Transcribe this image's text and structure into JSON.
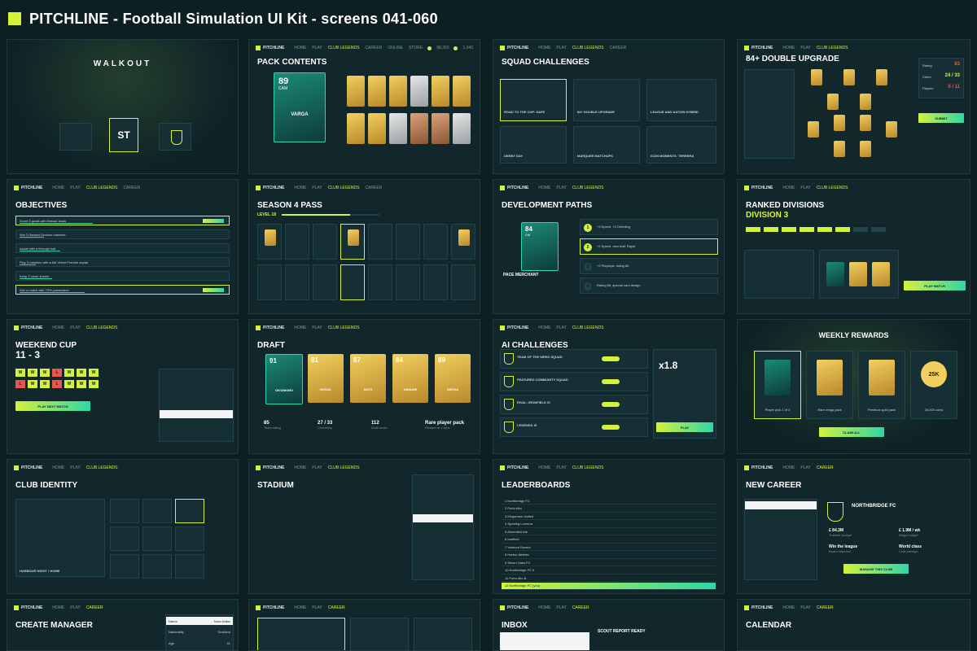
{
  "header": {
    "title": "PITCHLINE  -  Football Simulation UI Kit  -  screens 041-060"
  },
  "nav": [
    "HOME",
    "PLAY",
    "CLUB LEGENDS",
    "CAREER",
    "ONLINE",
    "STORE"
  ],
  "brand": "PITCHLINE",
  "coins": [
    "98,250",
    "1,340"
  ],
  "walkout": {
    "title": "WALKOUT",
    "slot_center": "ST"
  },
  "pack": {
    "title": "PACK CONTENTS",
    "rating": "89",
    "pos": "CAM",
    "name": "VARGA",
    "stats": [
      "84",
      "SPD",
      "89",
      "SHO",
      "91",
      "PAS",
      "86",
      "DRI",
      "60",
      "DEF",
      "82",
      "PHY"
    ]
  },
  "squad": {
    "title": "SQUAD CHALLENGES",
    "items": [
      "ROAD TO THE CUP: SAFE",
      "84+ DOUBLE UPGRADE",
      "LEAGUE AND NATION HYBRID",
      "DERBY DAY",
      "MARQUEE MATCHUPS",
      "ICON MOMENTS: TERRERA"
    ]
  },
  "upgrade": {
    "title": "84+ DOUBLE UPGRADE",
    "stats": [
      [
        "Rating",
        "83"
      ],
      [
        "Chem",
        "24 / 33"
      ],
      [
        "Players",
        "9 / 11"
      ]
    ],
    "submit": "SUBMIT"
  },
  "objectives": {
    "title": "OBJECTIVES",
    "rows": [
      "Score 5 goals with finesse shots",
      "Win 3 Ranked Division matches",
      "Assist with a through ball",
      "Play 3 matches with a full Velvet Premier squad",
      "Keep 2 clean sheets",
      "Win a match with 70% possession"
    ]
  },
  "pass": {
    "title": "SEASON 4 PASS",
    "level": "LEVEL 18"
  },
  "dev": {
    "title": "DEVELOPMENT PATHS",
    "rating": "84",
    "pos": "CM",
    "name": "PACE MERCHANT",
    "steps": [
      "+3 Speed, +2 Dribbling",
      "+2 Speed, new trait: Rapid",
      "+2 Playstyle, rating 86",
      "Rating 88, special card design"
    ]
  },
  "ranked": {
    "title": "RANKED DIVISIONS",
    "division": "DIVISION 3",
    "play": "PLAY MATCH"
  },
  "cup": {
    "title": "WEEKEND CUP",
    "score": "11 - 3",
    "results": [
      "W",
      "W",
      "W",
      "L",
      "W",
      "W",
      "W",
      "L",
      "W",
      "W",
      "L",
      "W",
      "W",
      "W"
    ],
    "play": "PLAY NEXT MATCH"
  },
  "draft": {
    "title": "DRAFT",
    "cards": [
      [
        "91",
        "OKONKWO"
      ],
      [
        "81",
        "NOVAK"
      ],
      [
        "87",
        "SATO"
      ],
      [
        "84",
        "HAIDARI"
      ],
      [
        "89",
        "VARGA"
      ]
    ],
    "stats": [
      [
        "85",
        "Team rating"
      ],
      [
        "27 / 33",
        "Chemistry"
      ],
      [
        "112",
        "Draft score"
      ],
      [
        "Rare player pack",
        "Reward at 4 wins"
      ]
    ]
  },
  "ai": {
    "title": "AI CHALLENGES",
    "rows": [
      "TEAM OF THE WEEK SQUAD",
      "FEATURED COMMUNITY SQUAD",
      "RIVAL: IRONFIELD XI",
      "LEGENDS XI"
    ],
    "mult": "x1.8",
    "play": "PLAY"
  },
  "weekly": {
    "title": "WEEKLY REWARDS",
    "rewards": [
      "Player pick 1 of 3",
      "Rare mega pack",
      "Premium gold pack",
      "25,000 coins"
    ],
    "coins": "25K",
    "claim": "CLAIM ALL"
  },
  "identity": {
    "title": "CLUB IDENTITY",
    "name": "HARBOUR NIGHT / HOME"
  },
  "stadium": {
    "title": "STADIUM"
  },
  "leaderboards": {
    "title": "LEADERBOARDS",
    "rows": [
      "Northbridge FC",
      "Porto Alto",
      "Kingsmere United",
      "Sporting Lucerna",
      "Ahnenfeld Ath.",
      "Ironfield",
      "Velmont Rovers",
      "Harbor Athletic",
      "Seven Oaks FC",
      "Northbridge FC II",
      "Porto Alto B",
      "Northbridge FC (you)"
    ]
  },
  "career": {
    "title": "NEW CAREER",
    "club": "NORTHBRIDGE FC",
    "stats": [
      [
        "£ 84.3M",
        "Transfer budget"
      ],
      [
        "£ 1.9M / wk",
        "Wage budget"
      ],
      [
        "Win the league",
        "Board objective"
      ],
      [
        "World class",
        "Club prestige"
      ]
    ],
    "manage": "MANAGE THIS CLUB"
  },
  "manager": {
    "title": "CREATE MANAGER",
    "fields": [
      [
        "Name",
        "Nora Kallar"
      ],
      [
        "Nationality",
        "Scotland"
      ],
      [
        "Age",
        "41"
      ]
    ]
  },
  "inbox": {
    "title": "INBOX",
    "msg": "SCOUT REPORT READY"
  },
  "calendar": {
    "title": "CALENDAR"
  }
}
